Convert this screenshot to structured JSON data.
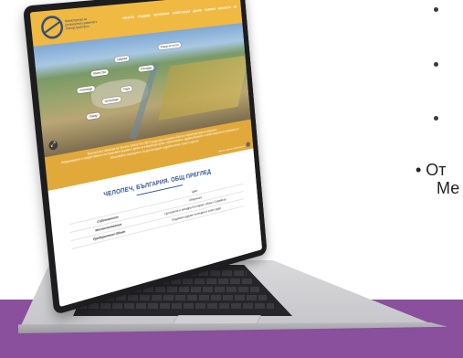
{
  "slide": {
    "bullet_count": 3,
    "bottom_text_line1": "• От",
    "bottom_text_line2": "Ме"
  },
  "site": {
    "logo_text": "Министерство на регионалното развитие и благоустройството",
    "nav": [
      "НАЧАЛО",
      "ГРАДОВЕ",
      "ТЕРИТОРИЯ",
      "ИНВЕСТИЦИИ",
      "ДАННИ",
      "НОВИНИ",
      "КОНТАКТИ",
      "EN"
    ],
    "hero": {
      "pins": [
        "Къща за гости",
        "Църква",
        "Кметство",
        "Площад",
        "Училище",
        "Парк",
        "Читалище",
        "Пазар"
      ]
    },
    "info_band": {
      "text1": "Виртуалната обиколка на Челопеч (Virtual Tour 360°) представя основните обекти и характеристики на общината.",
      "text2": "Информацията е предоставена в интерактивен формат с данни за инфраструктурата, образованието, здравеопазването и инвестиционните възможности.",
      "text3": "Използвайте навигацията, за да разгледате подробно всяка точка от картата.",
      "small": "Вижте повече информация"
    },
    "heading": "ЧЕЛОПЕЧ, БЪЛГАРИЯ. ОБЩ ПРЕГЛЕД",
    "table": [
      {
        "k": "",
        "v": "Цвят"
      },
      {
        "k": "Собственост",
        "v": "Общинска"
      },
      {
        "k": "Местоположение",
        "v": "Централна и западна България, област Софийска"
      },
      {
        "k": "Предприятие/ Обект",
        "v": "Подземен рудник на медни и злато руди"
      }
    ]
  }
}
